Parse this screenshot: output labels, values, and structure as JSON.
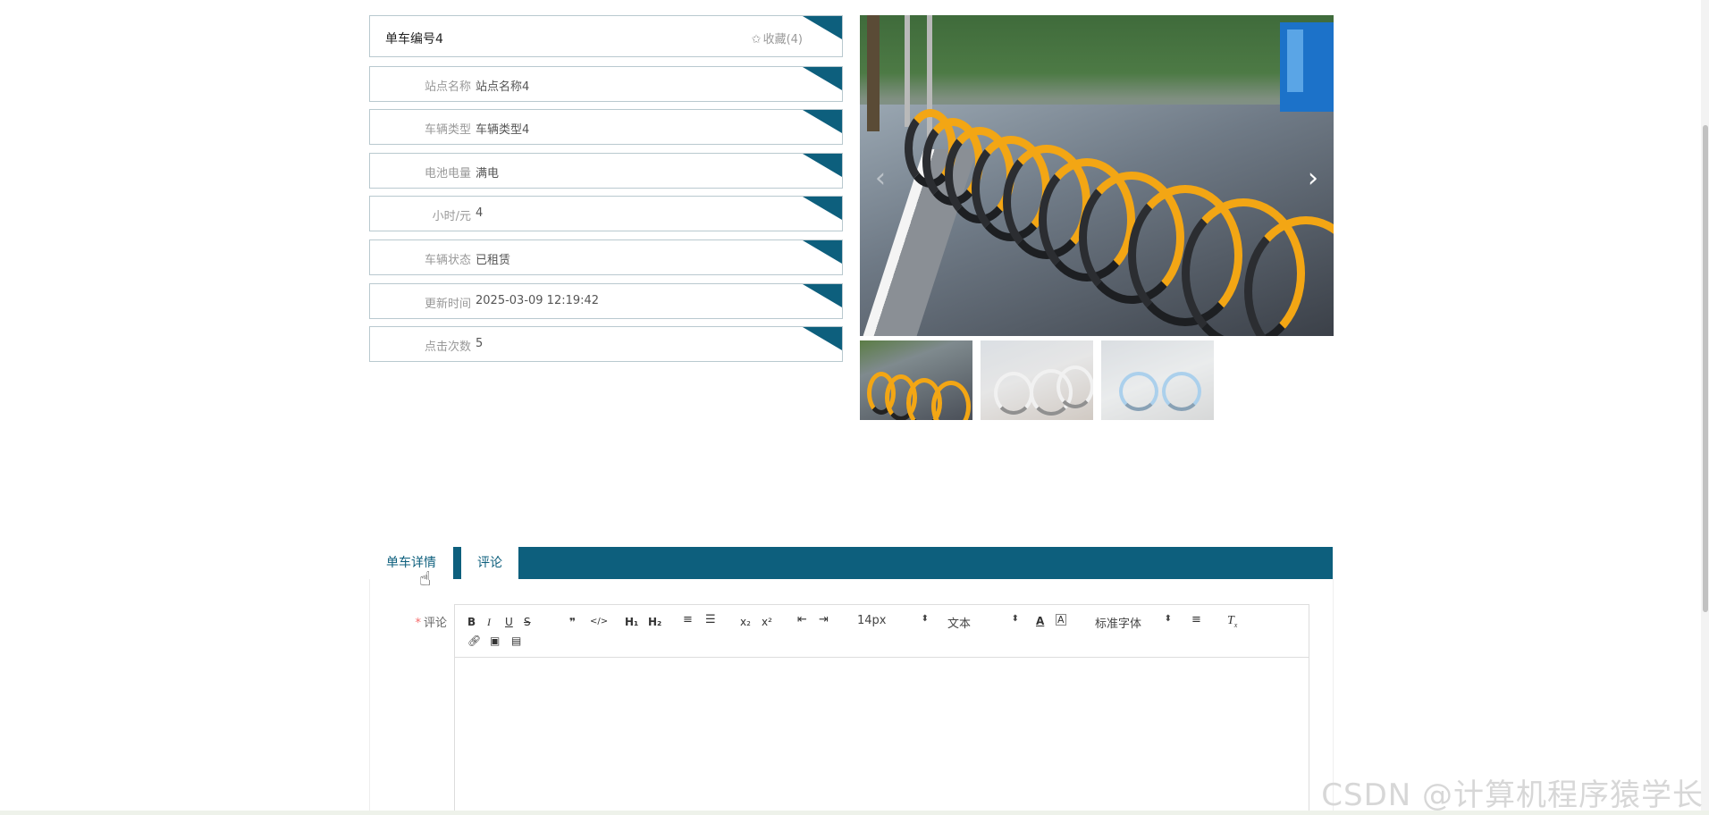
{
  "detail": {
    "title": "单车编号4",
    "favorite": "收藏(4)",
    "fields": [
      {
        "label": "站点名称",
        "value": "站点名称4"
      },
      {
        "label": "车辆类型",
        "value": "车辆类型4"
      },
      {
        "label": "电池电量",
        "value": "满电"
      },
      {
        "label": "小时/元",
        "value": "4"
      },
      {
        "label": "车辆状态",
        "value": "已租赁"
      },
      {
        "label": "更新时间",
        "value": "2025-03-09 12:19:42"
      },
      {
        "label": "点击次数",
        "value": "5"
      }
    ]
  },
  "tabs": {
    "detail": "单车详情",
    "comment": "评论"
  },
  "comment": {
    "required_mark": "*",
    "label": "评论"
  },
  "editor": {
    "font_size": "14px",
    "paragraph": "文本",
    "font_family": "标准字体"
  },
  "colors": {
    "accent": "#0d5f7d",
    "required": "#f56c6c"
  },
  "watermark": "CSDN @计算机程序猿学长"
}
